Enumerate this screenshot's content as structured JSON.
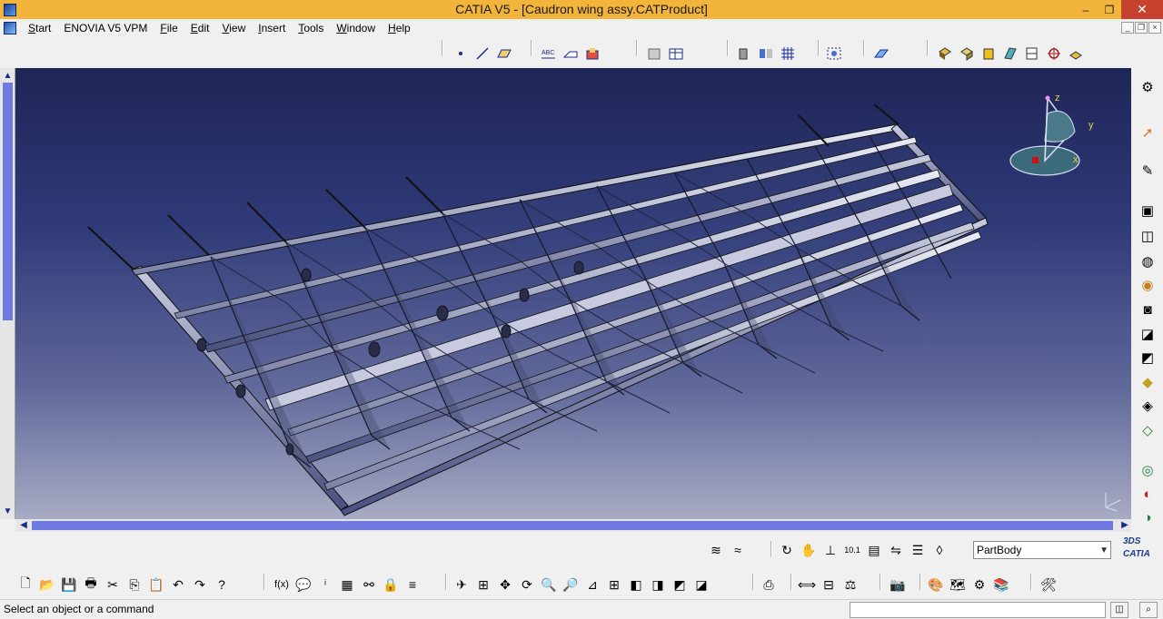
{
  "window": {
    "title": "CATIA V5 - [Caudron wing assy.CATProduct]",
    "minimize": "–",
    "restore": "❐",
    "close": "✕"
  },
  "menubar": {
    "items": [
      {
        "label": "Start",
        "mnemonic": "S",
        "rest": "tart"
      },
      {
        "label": "ENOVIA V5 VPM",
        "mnemonic": "",
        "rest": "ENOVIA V5 VPM"
      },
      {
        "label": "File",
        "mnemonic": "F",
        "rest": "ile"
      },
      {
        "label": "Edit",
        "mnemonic": "E",
        "rest": "dit"
      },
      {
        "label": "View",
        "mnemonic": "V",
        "rest": "iew"
      },
      {
        "label": "Insert",
        "mnemonic": "I",
        "rest": "nsert"
      },
      {
        "label": "Tools",
        "mnemonic": "T",
        "rest": "ools"
      },
      {
        "label": "Window",
        "mnemonic": "W",
        "rest": "indow"
      },
      {
        "label": "Help",
        "mnemonic": "H",
        "rest": "elp"
      }
    ]
  },
  "workbench": {
    "current_body": "PartBody",
    "logo": "3DS CATIA"
  },
  "compass": {
    "axis_x": "x",
    "axis_y": "y",
    "axis_z": "z"
  },
  "status": {
    "message": "Select an object or a command"
  },
  "colors": {
    "titlebar": "#f2b43a",
    "close_button": "#c7412f",
    "scroll_thumb": "#6f7ae0",
    "viewport_top": "#1e2557",
    "viewport_bottom": "#a8abc4"
  }
}
